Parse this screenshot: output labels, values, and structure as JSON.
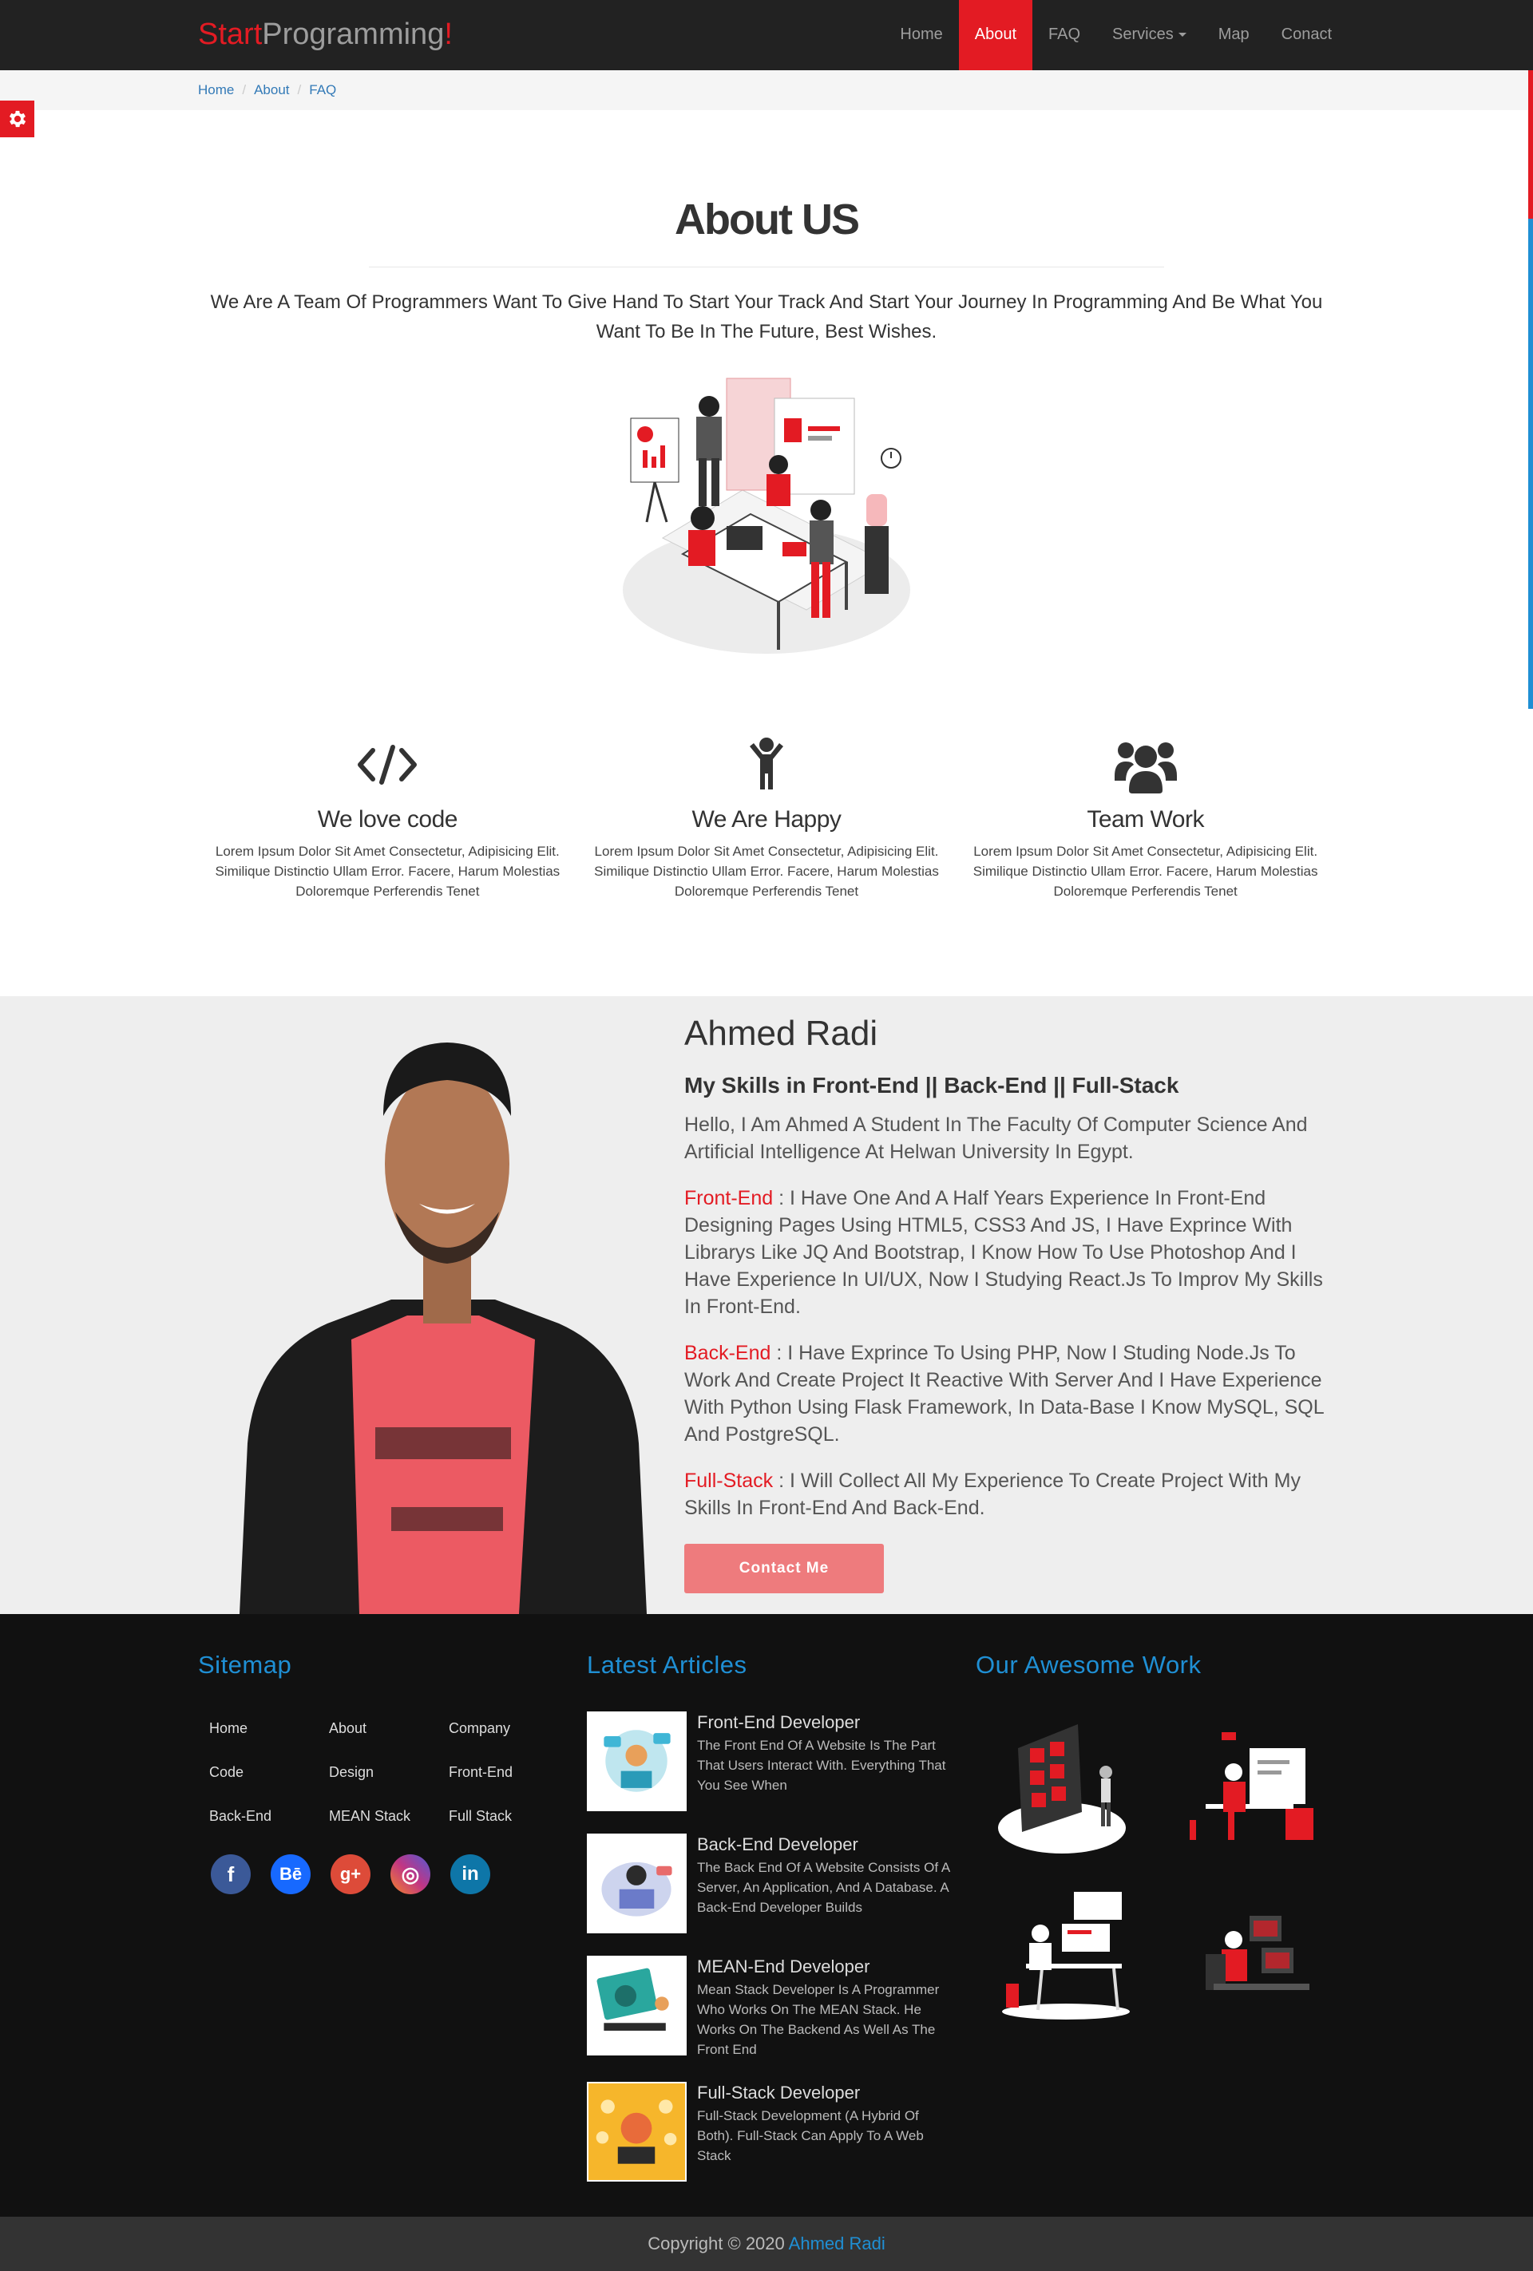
{
  "brand": {
    "part1": "Start",
    "part2": "Programming",
    "part3": "!"
  },
  "nav": {
    "items": [
      {
        "label": "Home"
      },
      {
        "label": "About"
      },
      {
        "label": "FAQ"
      },
      {
        "label": "Services"
      },
      {
        "label": "Map"
      },
      {
        "label": "Conact"
      }
    ],
    "active": "About"
  },
  "breadcrumb": [
    {
      "label": "Home"
    },
    {
      "label": "About"
    },
    {
      "label": "FAQ"
    }
  ],
  "about": {
    "title": "About US",
    "text": "We Are A Team Of Programmers Want To Give Hand To Start Your Track And Start Your Journey In Programming And Be What You Want To Be In The Future, Best Wishes."
  },
  "features": [
    {
      "icon": "code-icon",
      "title": "We love code",
      "text": "Lorem Ipsum Dolor Sit Amet Consectetur, Adipisicing Elit. Similique Distinctio Ullam Error. Facere, Harum Molestias Doloremque Perferendis Tenet"
    },
    {
      "icon": "child-icon",
      "title": "We Are Happy",
      "text": "Lorem Ipsum Dolor Sit Amet Consectetur, Adipisicing Elit. Similique Distinctio Ullam Error. Facere, Harum Molestias Doloremque Perferendis Tenet"
    },
    {
      "icon": "users-icon",
      "title": "Team Work",
      "text": "Lorem Ipsum Dolor Sit Amet Consectetur, Adipisicing Elit. Similique Distinctio Ullam Error. Facere, Harum Molestias Doloremque Perferendis Tenet"
    }
  ],
  "profile": {
    "name": "Ahmed Radi",
    "skills": "My Skills in Front-End || Back-End || Full-Stack",
    "intro": "Hello, I Am Ahmed A Student In The Faculty Of Computer Science And Artificial Intelligence At Helwan University In Egypt.",
    "frontend_label": "Front-End",
    "frontend_text": " : I Have One And A Half Years Experience In Front-End Designing Pages Using HTML5, CSS3 And JS, I Have Exprince With Librarys Like JQ And Bootstrap, I Know How To Use Photoshop And I Have Experience In UI/UX, Now I Studying React.Js To Improv My Skills In Front-End.",
    "backend_label": "Back-End",
    "backend_text": " : I Have Exprince To Using PHP, Now I Studing Node.Js To Work And Create Project It Reactive With Server And I Have Experience With Python Using Flask Framework, In Data-Base I Know MySQL, SQL And PostgreSQL.",
    "fullstack_label": "Full-Stack",
    "fullstack_text": " : I Will Collect All My Experience To Create Project With My Skills In Front-End And Back-End.",
    "contact_label": "Contact Me"
  },
  "footer": {
    "sitemap_title": "Sitemap",
    "sitemap_links": [
      "Home",
      "About",
      "Company",
      "Code",
      "Design",
      "Front-End",
      "Back-End",
      "MEAN Stack",
      "Full Stack"
    ],
    "socials": [
      {
        "name": "facebook",
        "glyph": "f",
        "color": "#3b5998"
      },
      {
        "name": "behance",
        "glyph": "Bē",
        "color": "#1769ff"
      },
      {
        "name": "google-plus",
        "glyph": "g+",
        "color": "#dd4b39"
      },
      {
        "name": "instagram",
        "glyph": "◎",
        "color": "#c13584"
      },
      {
        "name": "linkedin",
        "glyph": "in",
        "color": "#0e76a8"
      }
    ],
    "articles_title": "Latest Articles",
    "articles": [
      {
        "title": "Front-End Developer",
        "text": "The Front End Of A Website Is The Part That Users Interact With. Everything That You See When"
      },
      {
        "title": "Back-End Developer",
        "text": "The Back End Of A Website Consists Of A Server, An Application, And A Database. A Back-End Developer Builds"
      },
      {
        "title": "MEAN-End Developer",
        "text": "Mean Stack Developer Is A Programmer Who Works On The MEAN Stack. He Works On The Backend As Well As The Front End"
      },
      {
        "title": "Full-Stack Developer",
        "text": "Full-Stack Development (A Hybrid Of Both). Full-Stack Can Apply To A Web Stack"
      }
    ],
    "work_title": "Our Awesome Work"
  },
  "copyright": {
    "text": "Copyright © 2020 ",
    "author": "Ahmed Radi"
  },
  "colors": {
    "accent": "#e31b23",
    "link": "#1f8fd4",
    "navbar": "#222222",
    "footer": "#111111"
  }
}
